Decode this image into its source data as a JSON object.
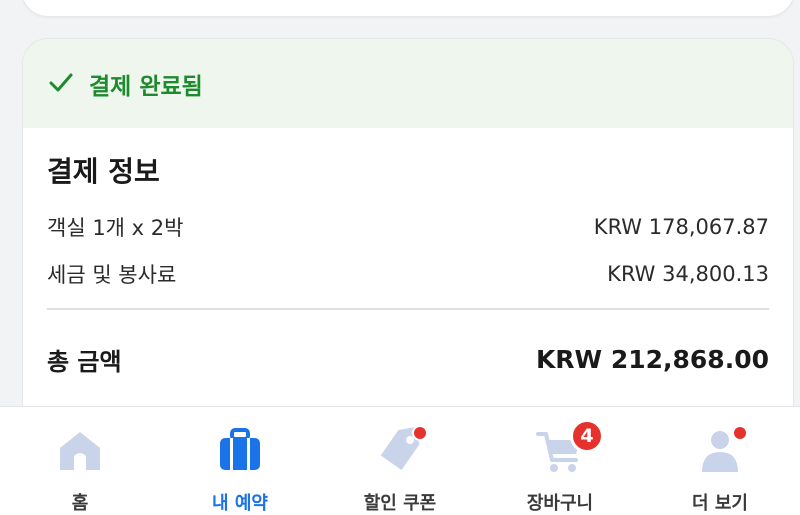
{
  "status": {
    "label": "결제 완료됨",
    "color": "#1e8a2e",
    "icon": "checkmark-icon"
  },
  "payment_info": {
    "title": "결제 정보",
    "items": [
      {
        "label": "객실 1개 x 2박",
        "amount": "KRW 178,067.87"
      },
      {
        "label": "세금 및 봉사료",
        "amount": "KRW 34,800.13"
      }
    ],
    "total": {
      "label": "총 금액",
      "amount": "KRW 212,868.00"
    }
  },
  "bottom_nav": {
    "items": [
      {
        "label": "홈",
        "icon": "home-icon",
        "active": false
      },
      {
        "label": "내 예약",
        "icon": "briefcase-icon",
        "active": true
      },
      {
        "label": "할인 쿠폰",
        "icon": "tag-icon",
        "active": false,
        "dot": true
      },
      {
        "label": "장바구니",
        "icon": "cart-icon",
        "active": false,
        "badge": "4"
      },
      {
        "label": "더 보기",
        "icon": "person-icon",
        "active": false,
        "dot": true
      }
    ],
    "active_color": "#1a73e8",
    "icon_color": "#c9d3ea",
    "notification_color": "#e5322d"
  }
}
